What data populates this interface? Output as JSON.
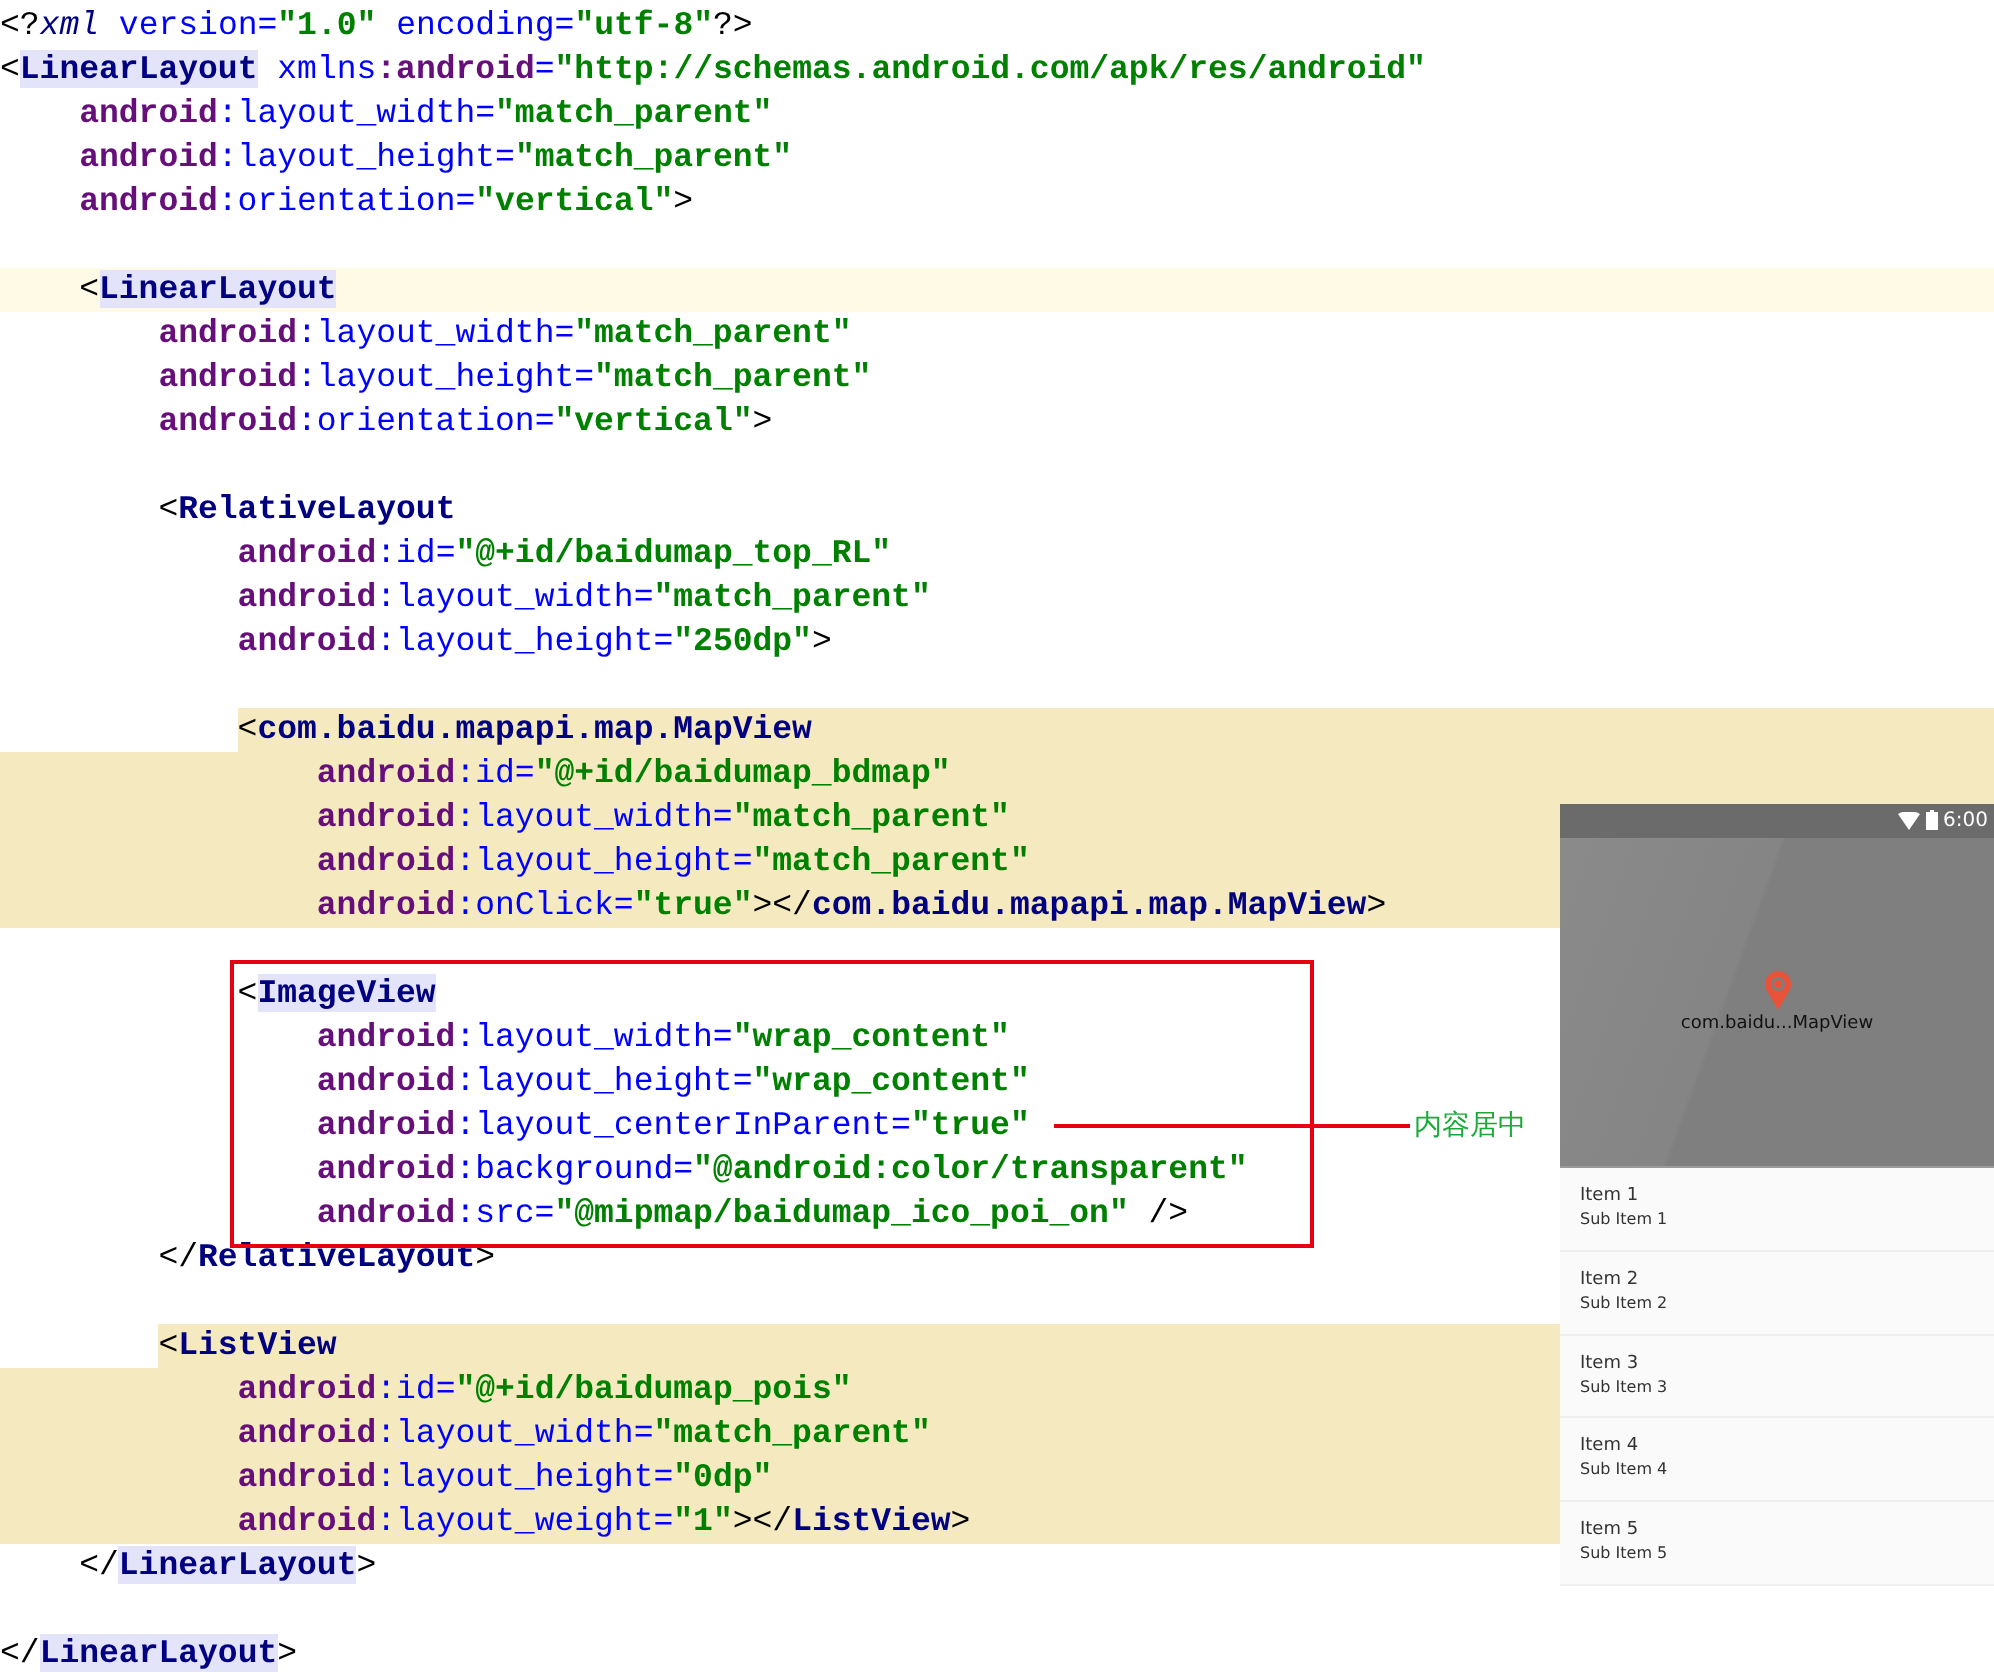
{
  "editor": {
    "lines": [
      {
        "kind": "plain",
        "parts": [
          {
            "kind": "punct",
            "text": "<?"
          },
          {
            "kind": "decl",
            "text": "xml"
          },
          {
            "kind": "attr",
            "text": " version="
          },
          {
            "kind": "value",
            "text": "\"1.0\""
          },
          {
            "kind": "attr",
            "text": " encoding="
          },
          {
            "kind": "value",
            "text": "\"utf-8\""
          },
          {
            "kind": "punct",
            "text": "?>"
          }
        ]
      },
      {
        "kind": "plain",
        "parts": [
          {
            "kind": "punct",
            "text": "<"
          },
          {
            "kind": "tag",
            "text": "LinearLayout",
            "matched": true
          },
          {
            "kind": "attr",
            "text": " xmlns"
          },
          {
            "kind": "ns",
            "text": ":android"
          },
          {
            "kind": "attr",
            "text": "="
          },
          {
            "kind": "value",
            "text": "\"http://schemas.android.com/apk/res/android\""
          }
        ],
        "children": [
          {
            "kind": "plain",
            "parts": [
              {
                "kind": "ns",
                "text": "android"
              },
              {
                "kind": "attr",
                "text": ":layout_width="
              },
              {
                "kind": "value",
                "text": "\"match_parent\""
              }
            ]
          },
          {
            "kind": "plain",
            "parts": [
              {
                "kind": "ns",
                "text": "android"
              },
              {
                "kind": "attr",
                "text": ":layout_height="
              },
              {
                "kind": "value",
                "text": "\"match_parent\""
              }
            ]
          },
          {
            "kind": "plain",
            "parts": [
              {
                "kind": "ns",
                "text": "android"
              },
              {
                "kind": "attr",
                "text": ":orientation="
              },
              {
                "kind": "value",
                "text": "\"vertical\""
              },
              {
                "kind": "punct",
                "text": ">"
              }
            ]
          },
          {
            "kind": "blank"
          },
          {
            "kind": "current",
            "parts": [
              {
                "kind": "punct",
                "text": "<"
              },
              {
                "kind": "tag",
                "text": "LinearLayout",
                "matched": true
              }
            ],
            "children": [
              {
                "kind": "plain",
                "parts": [
                  {
                    "kind": "ns",
                    "text": "android"
                  },
                  {
                    "kind": "attr",
                    "text": ":layout_width="
                  },
                  {
                    "kind": "value",
                    "text": "\"match_parent\""
                  }
                ]
              },
              {
                "kind": "plain",
                "parts": [
                  {
                    "kind": "ns",
                    "text": "android"
                  },
                  {
                    "kind": "attr",
                    "text": ":layout_height="
                  },
                  {
                    "kind": "value",
                    "text": "\"match_parent\""
                  }
                ]
              },
              {
                "kind": "plain",
                "parts": [
                  {
                    "kind": "ns",
                    "text": "android"
                  },
                  {
                    "kind": "attr",
                    "text": ":orientation="
                  },
                  {
                    "kind": "value",
                    "text": "\"vertical\""
                  },
                  {
                    "kind": "punct",
                    "text": ">"
                  }
                ]
              },
              {
                "kind": "blank"
              },
              {
                "kind": "plain",
                "parts": [
                  {
                    "kind": "punct",
                    "text": "<"
                  },
                  {
                    "kind": "tag",
                    "text": "RelativeLayout"
                  }
                ],
                "children": [
                  {
                    "kind": "plain",
                    "parts": [
                      {
                        "kind": "ns",
                        "text": "android"
                      },
                      {
                        "kind": "attr",
                        "text": ":id="
                      },
                      {
                        "kind": "value",
                        "text": "\"@+id/baidumap_top_RL\""
                      }
                    ]
                  },
                  {
                    "kind": "plain",
                    "parts": [
                      {
                        "kind": "ns",
                        "text": "android"
                      },
                      {
                        "kind": "attr",
                        "text": ":layout_width="
                      },
                      {
                        "kind": "value",
                        "text": "\"match_parent\""
                      }
                    ]
                  },
                  {
                    "kind": "plain",
                    "parts": [
                      {
                        "kind": "ns",
                        "text": "android"
                      },
                      {
                        "kind": "attr",
                        "text": ":layout_height="
                      },
                      {
                        "kind": "value",
                        "text": "\"250dp\""
                      },
                      {
                        "kind": "punct",
                        "text": ">"
                      }
                    ]
                  },
                  {
                    "kind": "blank"
                  },
                  {
                    "kind": "marked_start",
                    "parts": [
                      {
                        "kind": "punct",
                        "text": "<"
                      },
                      {
                        "kind": "tag",
                        "text": "com.baidu.mapapi.map.MapView"
                      }
                    ],
                    "children": [
                      {
                        "kind": "marked",
                        "parts": [
                          {
                            "kind": "ns",
                            "text": "android"
                          },
                          {
                            "kind": "attr",
                            "text": ":id="
                          },
                          {
                            "kind": "value",
                            "text": "\"@+id/baidumap_bdmap\""
                          }
                        ]
                      },
                      {
                        "kind": "marked",
                        "parts": [
                          {
                            "kind": "ns",
                            "text": "android"
                          },
                          {
                            "kind": "attr",
                            "text": ":layout_width="
                          },
                          {
                            "kind": "value",
                            "text": "\"match_parent\""
                          }
                        ]
                      },
                      {
                        "kind": "marked",
                        "parts": [
                          {
                            "kind": "ns",
                            "text": "android"
                          },
                          {
                            "kind": "attr",
                            "text": ":layout_height="
                          },
                          {
                            "kind": "value",
                            "text": "\"match_parent\""
                          }
                        ]
                      },
                      {
                        "kind": "marked",
                        "parts": [
                          {
                            "kind": "ns",
                            "text": "android"
                          },
                          {
                            "kind": "attr",
                            "text": ":onClick="
                          },
                          {
                            "kind": "value",
                            "text": "\"true\""
                          },
                          {
                            "kind": "punct",
                            "text": "></"
                          },
                          {
                            "kind": "tag",
                            "text": "com.baidu.mapapi.map.MapView"
                          },
                          {
                            "kind": "punct",
                            "text": ">"
                          }
                        ]
                      }
                    ]
                  },
                  {
                    "kind": "blank"
                  },
                  {
                    "kind": "plain",
                    "parts": [
                      {
                        "kind": "punct",
                        "text": "<"
                      },
                      {
                        "kind": "tag",
                        "text": "ImageView",
                        "matched": true
                      }
                    ],
                    "children": [
                      {
                        "kind": "plain",
                        "parts": [
                          {
                            "kind": "ns",
                            "text": "android"
                          },
                          {
                            "kind": "attr",
                            "text": ":layout_width="
                          },
                          {
                            "kind": "value",
                            "text": "\"wrap_content\""
                          }
                        ]
                      },
                      {
                        "kind": "plain",
                        "parts": [
                          {
                            "kind": "ns",
                            "text": "android"
                          },
                          {
                            "kind": "attr",
                            "text": ":layout_height="
                          },
                          {
                            "kind": "value",
                            "text": "\"wrap_content\""
                          }
                        ]
                      },
                      {
                        "kind": "plain",
                        "parts": [
                          {
                            "kind": "ns",
                            "text": "android"
                          },
                          {
                            "kind": "attr",
                            "text": ":layout_centerInParent="
                          },
                          {
                            "kind": "value",
                            "text": "\"true\""
                          }
                        ]
                      },
                      {
                        "kind": "plain",
                        "parts": [
                          {
                            "kind": "ns",
                            "text": "android"
                          },
                          {
                            "kind": "attr",
                            "text": ":background="
                          },
                          {
                            "kind": "value",
                            "text": "\"@android:color/transparent\""
                          }
                        ]
                      },
                      {
                        "kind": "plain",
                        "parts": [
                          {
                            "kind": "ns",
                            "text": "android"
                          },
                          {
                            "kind": "attr",
                            "text": ":src="
                          },
                          {
                            "kind": "value",
                            "text": "\"@mipmap/baidumap_ico_poi_on\""
                          },
                          {
                            "kind": "punct",
                            "text": " />"
                          }
                        ]
                      }
                    ]
                  }
                ]
              },
              {
                "kind": "plain",
                "parts": [
                  {
                    "kind": "punct",
                    "text": "</"
                  },
                  {
                    "kind": "tag",
                    "text": "RelativeLayout"
                  },
                  {
                    "kind": "punct",
                    "text": ">"
                  }
                ]
              },
              {
                "kind": "blank"
              },
              {
                "kind": "marked_start",
                "parts": [
                  {
                    "kind": "punct",
                    "text": "<"
                  },
                  {
                    "kind": "tag",
                    "text": "ListView"
                  }
                ],
                "children": [
                  {
                    "kind": "marked",
                    "parts": [
                      {
                        "kind": "ns",
                        "text": "android"
                      },
                      {
                        "kind": "attr",
                        "text": ":id="
                      },
                      {
                        "kind": "value",
                        "text": "\"@+id/baidumap_pois\""
                      }
                    ]
                  },
                  {
                    "kind": "marked",
                    "parts": [
                      {
                        "kind": "ns",
                        "text": "android"
                      },
                      {
                        "kind": "attr",
                        "text": ":layout_width="
                      },
                      {
                        "kind": "value",
                        "text": "\"match_parent\""
                      }
                    ]
                  },
                  {
                    "kind": "marked",
                    "parts": [
                      {
                        "kind": "ns",
                        "text": "android"
                      },
                      {
                        "kind": "attr",
                        "text": ":layout_height="
                      },
                      {
                        "kind": "value",
                        "text": "\"0dp\""
                      }
                    ]
                  },
                  {
                    "kind": "marked",
                    "parts": [
                      {
                        "kind": "ns",
                        "text": "android"
                      },
                      {
                        "kind": "attr",
                        "text": ":layout_weight="
                      },
                      {
                        "kind": "value",
                        "text": "\"1\""
                      },
                      {
                        "kind": "punct",
                        "text": "></"
                      },
                      {
                        "kind": "tag",
                        "text": "ListView"
                      },
                      {
                        "kind": "punct",
                        "text": ">"
                      }
                    ]
                  }
                ]
              }
            ]
          },
          {
            "kind": "plain",
            "parts": [
              {
                "kind": "punct",
                "text": "</"
              },
              {
                "kind": "tag",
                "text": "LinearLayout",
                "matched": true
              },
              {
                "kind": "punct",
                "text": ">"
              }
            ]
          },
          {
            "kind": "blank"
          }
        ]
      },
      {
        "kind": "plain",
        "parts": [
          {
            "kind": "punct",
            "text": "</"
          },
          {
            "kind": "tag",
            "text": "LinearLayout",
            "matched": true
          },
          {
            "kind": "punct",
            "text": ">"
          }
        ]
      }
    ]
  },
  "annotation": {
    "label": "内容居中"
  },
  "preview": {
    "status_bar": {
      "time": "6:00"
    },
    "map_label": "com.baidu...MapView",
    "list_items": [
      {
        "title": "Item 1",
        "subtitle": "Sub Item 1"
      },
      {
        "title": "Item 2",
        "subtitle": "Sub Item 2"
      },
      {
        "title": "Item 3",
        "subtitle": "Sub Item 3"
      },
      {
        "title": "Item 4",
        "subtitle": "Sub Item 4"
      },
      {
        "title": "Item 5",
        "subtitle": "Sub Item 5"
      }
    ]
  }
}
